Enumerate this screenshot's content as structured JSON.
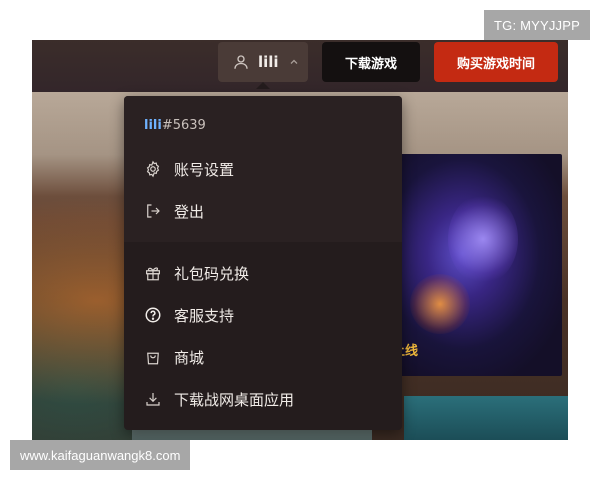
{
  "watermarks": {
    "top": "TG: MYYJJPP",
    "bottom": "www.kaifaguanwangk8.com"
  },
  "header": {
    "account": {
      "username": "lili",
      "icon": "user-icon",
      "chevron": "chevron-up-icon"
    },
    "download_label": "下载游戏",
    "buy_label": "购买游戏时间"
  },
  "dropdown": {
    "user_tag": {
      "name": "lili",
      "number": "#5639"
    },
    "primary_items": [
      {
        "label": "账号设置",
        "icon": "gear-icon"
      },
      {
        "label": "登出",
        "icon": "logout-icon"
      }
    ],
    "secondary_items": [
      {
        "label": "礼包码兑换",
        "icon": "gift-icon"
      },
      {
        "label": "客服支持",
        "icon": "help-circle-icon"
      },
      {
        "label": "商城",
        "icon": "shopping-bag-icon"
      },
      {
        "label": "下载战网桌面应用",
        "icon": "download-icon"
      }
    ]
  },
  "background": {
    "card_caption": "上线"
  },
  "colors": {
    "buy_button": "#c42a12",
    "download_button": "#141010",
    "dropdown_bg": "#241c1d",
    "username_accent": "#6fb2ff",
    "caption_gold": "#f1b93b"
  }
}
